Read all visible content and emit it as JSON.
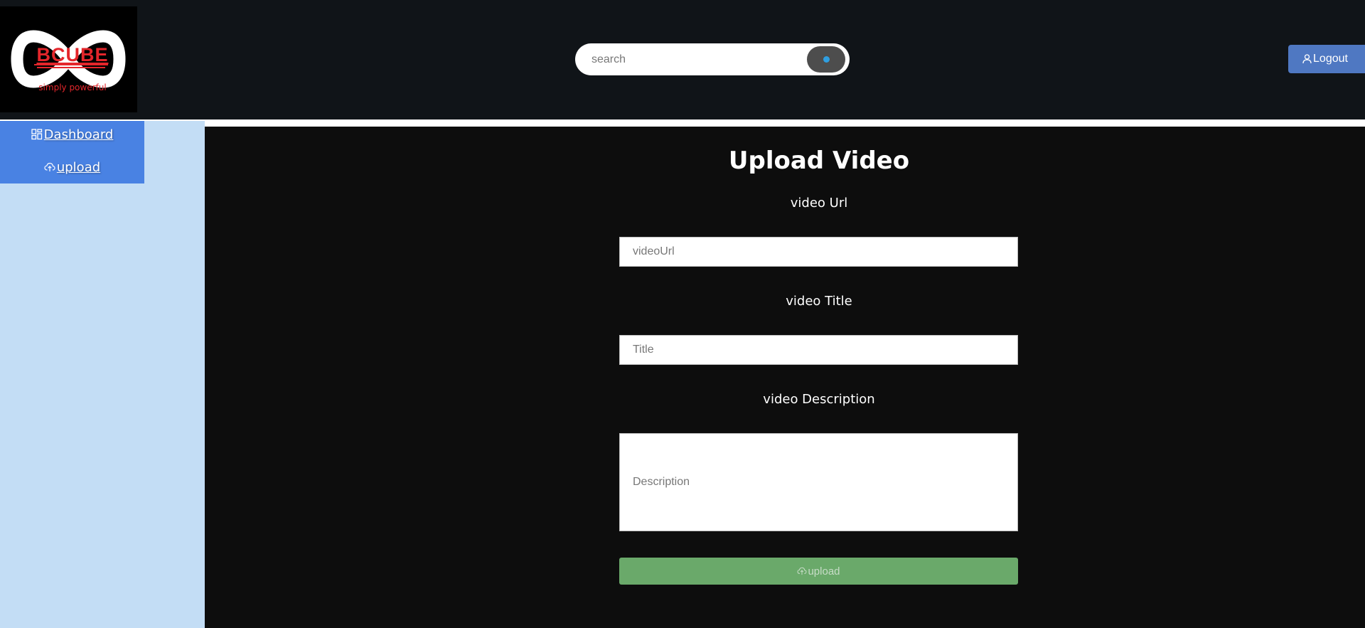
{
  "header": {
    "logo": {
      "text": "BCUBE",
      "tagline": "simply powerful"
    },
    "search": {
      "placeholder": "search",
      "value": "",
      "button_icon": "search-icon"
    },
    "logout": {
      "icon": "user-icon",
      "label": "Logout"
    }
  },
  "sidebar": {
    "items": [
      {
        "icon": "dashboard-grid-icon",
        "label": "Dashboard"
      },
      {
        "icon": "cloud-upload-icon",
        "label": "upload"
      }
    ]
  },
  "form": {
    "title": "Upload Video",
    "url": {
      "label": "video Url",
      "placeholder": "videoUrl",
      "value": ""
    },
    "title_field": {
      "label": "video Title",
      "placeholder": "Title",
      "value": ""
    },
    "description": {
      "label": "video Description",
      "placeholder": "Description",
      "value": ""
    },
    "submit": {
      "icon": "cloud-upload-icon",
      "label": "upload"
    }
  },
  "colors": {
    "header_bg": "#101418",
    "sidebar_bg": "#c3ddf5",
    "sidebar_nav": "#4982e3",
    "main_bg": "#0d0d0d",
    "logout_button": "#4f78c2",
    "upload_button": "#6aa96a",
    "brand_red": "#e4262b"
  }
}
